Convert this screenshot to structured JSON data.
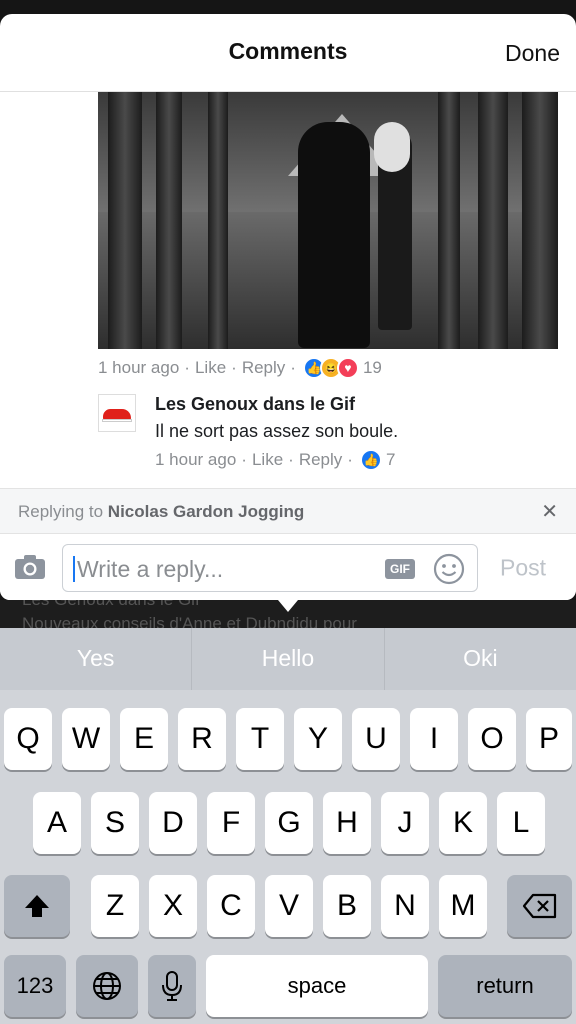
{
  "header": {
    "title": "Comments",
    "done_label": "Done"
  },
  "comment": {
    "time": "1 hour ago",
    "like_label": "Like",
    "reply_label": "Reply",
    "reaction_count": "19"
  },
  "reply": {
    "author": "Les Genoux dans le Gif",
    "text": "Il ne sort pas assez son boule.",
    "time": "1 hour ago",
    "like_label": "Like",
    "reply_label": "Reply",
    "reaction_count": "7"
  },
  "replying_to": {
    "prefix": "Replying to",
    "name": "Nicolas Gardon Jogging",
    "close_glyph": "✕"
  },
  "composer": {
    "placeholder": "Write a reply...",
    "gif_label": "GIF",
    "post_label": "Post"
  },
  "backdrop": {
    "line1": "Les Genoux dans le Gif",
    "line2": "Nouveaux conseils d'Anne et Dubndidu pour"
  },
  "keyboard": {
    "suggestions": [
      "Yes",
      "Hello",
      "Oki"
    ],
    "row1": [
      "Q",
      "W",
      "E",
      "R",
      "T",
      "Y",
      "U",
      "I",
      "O",
      "P"
    ],
    "row2": [
      "A",
      "S",
      "D",
      "F",
      "G",
      "H",
      "J",
      "K",
      "L"
    ],
    "row3": [
      "Z",
      "X",
      "C",
      "V",
      "B",
      "N",
      "M"
    ],
    "numbers_label": "123",
    "space_label": "space",
    "return_label": "return"
  },
  "colors": {
    "accent": "#1877f2",
    "love": "#f33e58",
    "haha": "#f7b125"
  }
}
